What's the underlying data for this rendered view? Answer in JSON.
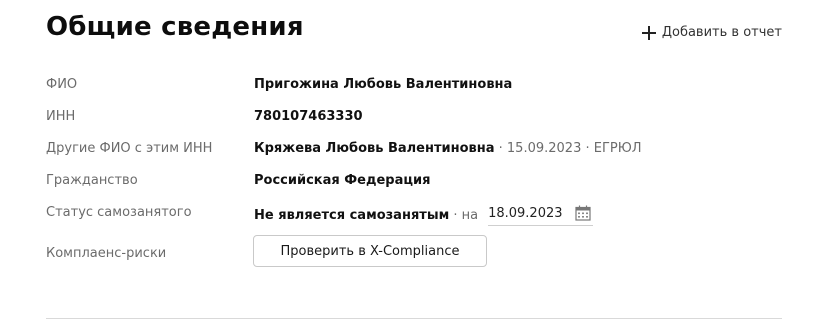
{
  "header": {
    "title": "Общие сведения",
    "add_to_report_label": "Добавить в отчет"
  },
  "rows": [
    {
      "label": "ФИО",
      "value": "Пригожина Любовь Валентиновна"
    },
    {
      "label": "ИНН",
      "value": "780107463330"
    },
    {
      "label": "Другие ФИО с этим ИНН",
      "value": "Кряжева Любовь Валентиновна",
      "suffix": " · 15.09.2023 · ЕГРЮЛ"
    },
    {
      "label": "Гражданство",
      "value": "Российская Федерация"
    },
    {
      "label": "Статус самозанятого",
      "value": "Не является самозанятым",
      "suffix": " · на",
      "date": "18.09.2023"
    },
    {
      "label": "Комплаенс-риски",
      "button_label": "Проверить в X-Compliance"
    }
  ],
  "icons": {
    "add": "plus-icon",
    "date_picker": "calendar-icon"
  }
}
